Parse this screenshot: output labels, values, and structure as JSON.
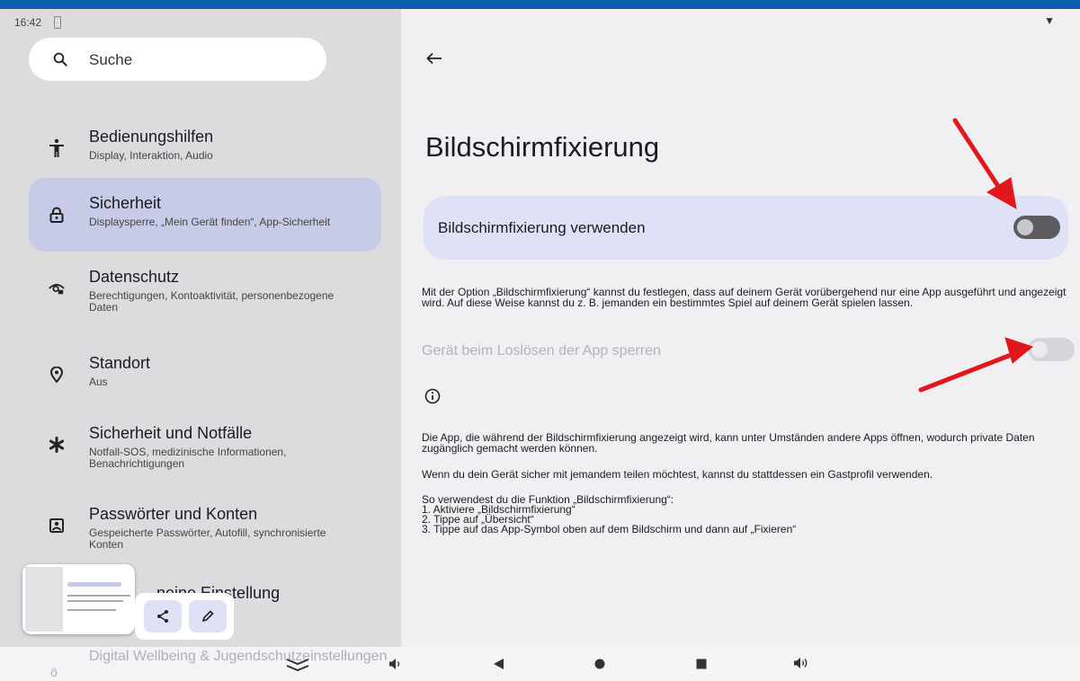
{
  "status_bar": {
    "time": "16:42"
  },
  "search": {
    "placeholder": "Suche"
  },
  "sidebar": {
    "items": [
      {
        "title": "Bedienungshilfen",
        "subtitle": "Display, Interaktion, Audio",
        "icon": "accessibility-icon"
      },
      {
        "title": "Sicherheit",
        "subtitle": "Displaysperre, „Mein Gerät finden“, App-Sicherheit",
        "icon": "lock-icon",
        "active": true
      },
      {
        "title": "Datenschutz",
        "subtitle": "Berechtigungen, Kontoaktivität, personenbezogene Daten",
        "icon": "privacy-eye-icon"
      },
      {
        "title": "Standort",
        "subtitle": "Aus",
        "icon": "location-pin-icon"
      },
      {
        "title": "Sicherheit und Notfälle",
        "subtitle": "Notfall-SOS, medizinische Informationen, Benachrichtigungen",
        "icon": "asterisk-icon"
      },
      {
        "title": "Passwörter und Konten",
        "subtitle": "Gespeicherte Passwörter, Autofill, synchronisierte Konten",
        "icon": "account-box-icon"
      },
      {
        "title": "neine Einstellung",
        "subtitle": "",
        "icon": "settings-icon"
      },
      {
        "title": "Digital Wellbeing & Jugendschutzeinstellungen",
        "subtitle": "",
        "icon": "wellbeing-icon"
      }
    ]
  },
  "main": {
    "title": "Bildschirmfixierung",
    "toggle_label": "Bildschirmfixierung verwenden",
    "toggle_on": false,
    "description": "Mit der Option „Bildschirmfixierung“ kannst du festlegen, dass auf deinem Gerät vorübergehend nur eine App ausgeführt und angezeigt wird. Auf diese Weise kannst du z. B. jemanden ein bestimmtes Spiel auf deinem Gerät spielen lassen.",
    "lock_label": "Gerät beim Loslösen der App sperren",
    "lock_enabled": false,
    "info_text_1": "Die App, die während der Bildschirmfixierung angezeigt wird, kann unter Umständen andere Apps öffnen, wodurch private Daten zugänglich gemacht werden können.",
    "info_text_2": "Wenn du dein Gerät sicher mit jemandem teilen möchtest, kannst du stattdessen ein Gastprofil verwenden.",
    "steps_intro": "So verwendest du die Funktion „Bildschirmfixierung“:",
    "steps": [
      "1. Aktiviere „Bildschirmfixierung“",
      "2. Tippe auf „Übersicht“",
      "3. Tippe auf das App-Symbol oben auf dem Bildschirm und dann auf „Fixieren“"
    ]
  },
  "colors": {
    "active_item": "#c7cbe8",
    "card": "#dfe2f7",
    "annotation_arrow": "#e3161c",
    "top_bar": "#0a5fad"
  }
}
